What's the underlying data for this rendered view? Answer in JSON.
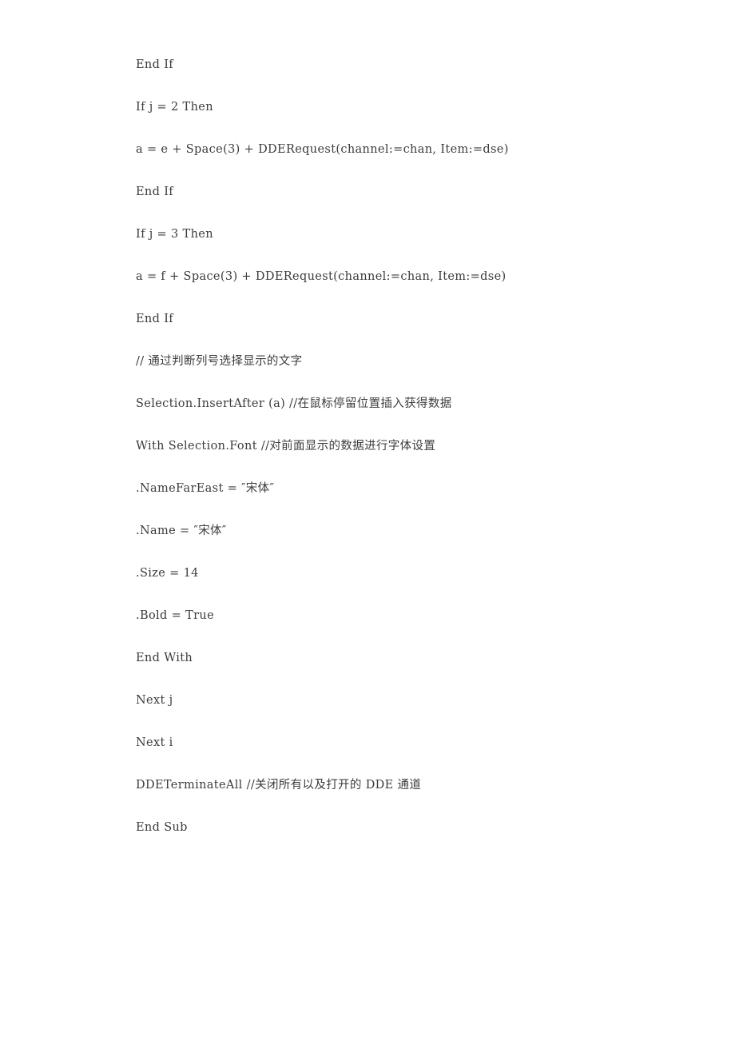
{
  "document": {
    "page_background": "#ffffff",
    "text_color": "#3c3c3c",
    "language": "Visual Basic for Applications (VBA)",
    "lines": [
      {
        "id": "line-1",
        "text": "End If"
      },
      {
        "id": "line-2",
        "text": "If j = 2 Then"
      },
      {
        "id": "line-3",
        "text": "a = e + Space(3) + DDERequest(channel:=chan, Item:=dse)"
      },
      {
        "id": "line-4",
        "text": "End If"
      },
      {
        "id": "line-5",
        "text": "If j = 3 Then"
      },
      {
        "id": "line-6",
        "text": "a = f + Space(3) + DDERequest(channel:=chan, Item:=dse)"
      },
      {
        "id": "line-7",
        "text": "End If"
      },
      {
        "id": "line-8",
        "text": "// 通过判断列号选择显示的文字"
      },
      {
        "id": "line-9",
        "text": "Selection.InsertAfter (a) //在鼠标停留位置插入获得数据"
      },
      {
        "id": "line-10",
        "text": "With Selection.Font //对前面显示的数据进行字体设置"
      },
      {
        "id": "line-11",
        "text": ".NameFarEast = ″宋体″"
      },
      {
        "id": "line-12",
        "text": ".Name = ″宋体″"
      },
      {
        "id": "line-13",
        "text": ".Size = 14"
      },
      {
        "id": "line-14",
        "text": ".Bold = True"
      },
      {
        "id": "line-15",
        "text": "End With"
      },
      {
        "id": "line-16",
        "text": "Next j"
      },
      {
        "id": "line-17",
        "text": "Next i"
      },
      {
        "id": "line-18",
        "text": "DDETerminateAll //关闭所有以及打开的 DDE 通道"
      },
      {
        "id": "line-19",
        "text": "End Sub"
      }
    ]
  }
}
